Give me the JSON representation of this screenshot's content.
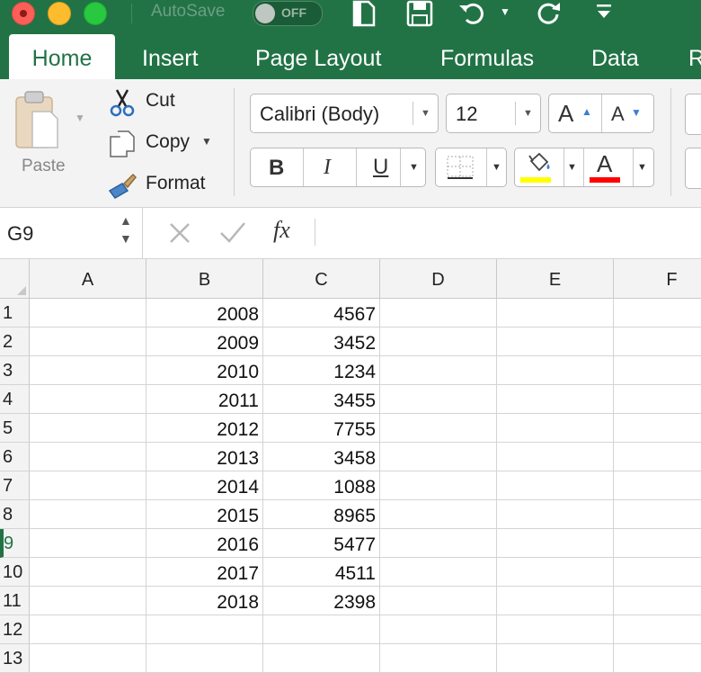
{
  "titlebar": {
    "autosave_label": "AutoSave",
    "autosave_state": "OFF",
    "icons": [
      "close-icon",
      "minimize-icon",
      "zoom-icon",
      "open-icon",
      "save-icon",
      "undo-icon",
      "redo-icon",
      "customize-toolbar-icon"
    ]
  },
  "tabs": [
    "Home",
    "Insert",
    "Page Layout",
    "Formulas",
    "Data",
    "R"
  ],
  "active_tab": "Home",
  "ribbon": {
    "paste": "Paste",
    "cut": "Cut",
    "copy": "Copy",
    "format": "Format",
    "font_name": "Calibri (Body)",
    "font_size": "12",
    "grow_font": "A",
    "shrink_font": "A",
    "bold": "B",
    "italic": "I",
    "underline": "U",
    "font_color_glyph": "A",
    "fill_color": "#ffff00",
    "font_color": "#ff0000"
  },
  "formula_bar": {
    "name_box": "G9",
    "fx": "fx",
    "formula": ""
  },
  "grid": {
    "columns": [
      "A",
      "B",
      "C",
      "D",
      "E",
      "F"
    ],
    "rows": [
      {
        "num": "1",
        "B": "2008",
        "C": "4567"
      },
      {
        "num": "2",
        "B": "2009",
        "C": "3452"
      },
      {
        "num": "3",
        "B": "2010",
        "C": "1234"
      },
      {
        "num": "4",
        "B": "2011",
        "C": "3455"
      },
      {
        "num": "5",
        "B": "2012",
        "C": "7755"
      },
      {
        "num": "6",
        "B": "2013",
        "C": "3458"
      },
      {
        "num": "7",
        "B": "2014",
        "C": "1088"
      },
      {
        "num": "8",
        "B": "2015",
        "C": "8965"
      },
      {
        "num": "9",
        "B": "2016",
        "C": "5477"
      },
      {
        "num": "10",
        "B": "2017",
        "C": "4511"
      },
      {
        "num": "11",
        "B": "2018",
        "C": "2398"
      },
      {
        "num": "12",
        "B": "",
        "C": ""
      },
      {
        "num": "13",
        "B": "",
        "C": ""
      }
    ],
    "selected_row": "9",
    "accent_color": "#217346"
  }
}
